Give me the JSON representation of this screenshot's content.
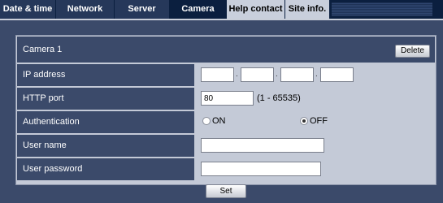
{
  "tabs": [
    {
      "label": "Date & time"
    },
    {
      "label": "Network"
    },
    {
      "label": "Server"
    },
    {
      "label": "Camera"
    },
    {
      "label": "Help contact"
    },
    {
      "label": "Site info."
    }
  ],
  "camera": {
    "title": "Camera 1",
    "delete_label": "Delete"
  },
  "fields": {
    "ip_address": {
      "label": "IP address",
      "separator": ".",
      "octets": [
        "",
        "",
        "",
        ""
      ]
    },
    "http_port": {
      "label": "HTTP port",
      "value": "80",
      "range": "(1 - 65535)"
    },
    "authentication": {
      "label": "Authentication",
      "on_label": "ON",
      "off_label": "OFF",
      "selected": "OFF"
    },
    "user_name": {
      "label": "User name",
      "value": ""
    },
    "user_password": {
      "label": "User password",
      "value": ""
    }
  },
  "set_label": "Set",
  "colors": {
    "background": "#3b4a6a",
    "tab_bar": "#0b1f3f",
    "value_cell": "#c4cad7"
  }
}
